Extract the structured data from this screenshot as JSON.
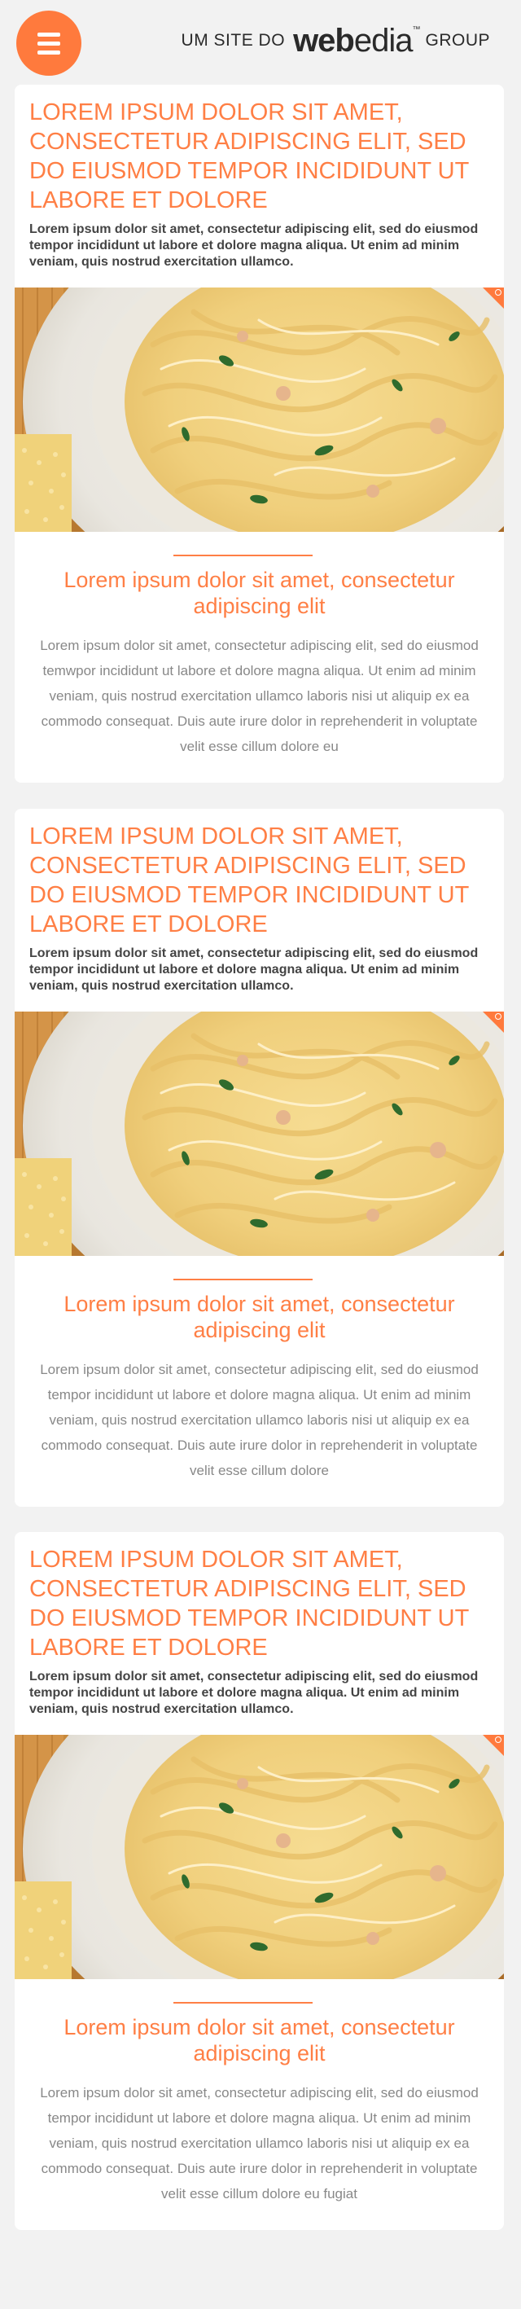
{
  "header": {
    "menu_icon": "hamburger-menu-icon",
    "brand_prefix": "UM SITE DO",
    "brand_logo_bold": "web",
    "brand_logo_light": "edia",
    "brand_trademark": "™",
    "brand_suffix": "GROUP"
  },
  "colors": {
    "accent": "#ff7a3d",
    "title": "#ff7f45",
    "background": "#f2f2f2",
    "card": "#ffffff"
  },
  "articles": [
    {
      "title": "LOREM IPSUM DOLOR SIT AMET, CONSECTETUR ADIPISCING ELIT, SED DO EIUSMOD TEMPOR INCIDIDUNT UT LABORE ET DOLORE",
      "lead": "Lorem ipsum dolor sit amet, consectetur adipiscing elit, sed do eiusmod tempor incididunt ut labore et dolore magna aliqua. Ut enim ad minim veniam, quis nostrud exercitation ullamco.",
      "image_icon": "pasta-dish-photo",
      "zoom_icon": "zoom-icon",
      "subtitle": "Lorem ipsum dolor sit amet, consectetur adipiscing elit",
      "body": "Lorem ipsum dolor sit amet, consectetur adipiscing elit, sed do eiusmod temwpor incididunt ut labore et dolore magna aliqua. Ut enim ad minim veniam, quis nostrud exercitation ullamco laboris nisi ut aliquip ex ea commodo consequat. Duis aute irure dolor in reprehenderit in voluptate velit esse cillum dolore eu"
    },
    {
      "title": "LOREM IPSUM DOLOR SIT AMET, CONSECTETUR ADIPISCING ELIT, SED DO EIUSMOD TEMPOR INCIDIDUNT UT LABORE ET DOLORE",
      "lead": "Lorem ipsum dolor sit amet, consectetur adipiscing elit, sed do eiusmod tempor incididunt ut labore et dolore magna aliqua. Ut enim ad minim veniam, quis nostrud exercitation ullamco.",
      "image_icon": "pasta-dish-photo",
      "zoom_icon": "zoom-icon",
      "subtitle": "Lorem ipsum dolor sit amet, consectetur adipiscing elit",
      "body": "Lorem ipsum dolor sit amet, consectetur adipiscing elit, sed do eiusmod tempor incididunt ut labore et dolore magna aliqua. Ut enim ad minim veniam, quis nostrud exercitation ullamco laboris nisi ut aliquip ex ea commodo consequat. Duis aute irure dolor in reprehenderit in voluptate velit esse cillum dolore"
    },
    {
      "title": "LOREM IPSUM DOLOR SIT AMET, CONSECTETUR ADIPISCING ELIT, SED DO EIUSMOD TEMPOR INCIDIDUNT UT LABORE ET DOLORE",
      "lead": "Lorem ipsum dolor sit amet, consectetur adipiscing elit, sed do eiusmod tempor incididunt ut labore et dolore magna aliqua. Ut enim ad minim veniam, quis nostrud exercitation ullamco.",
      "image_icon": "pasta-dish-photo",
      "zoom_icon": "zoom-icon",
      "subtitle": "Lorem ipsum dolor sit amet, consectetur adipiscing elit",
      "body": "Lorem ipsum dolor sit amet, consectetur adipiscing elit, sed do eiusmod tempor incididunt ut labore et dolore magna aliqua. Ut enim ad minim veniam, quis nostrud exercitation ullamco laboris nisi ut aliquip ex ea commodo consequat. Duis aute irure dolor in reprehenderit in voluptate velit esse cillum dolore eu fugiat"
    }
  ]
}
